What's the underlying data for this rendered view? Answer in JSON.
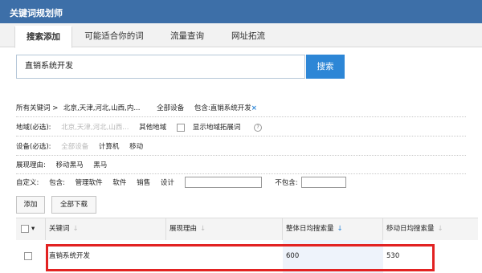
{
  "app": {
    "title": "关键词规划师"
  },
  "tabs": [
    {
      "label": "搜索添加"
    },
    {
      "label": "可能适合你的词"
    },
    {
      "label": "流量查询"
    },
    {
      "label": "网址拓流"
    }
  ],
  "search": {
    "value": "直销系统开发",
    "button": "搜索"
  },
  "breadcrumb": {
    "root": "所有关键词 >",
    "region": "北京,天津,河北,山西,内...",
    "device": "全部设备",
    "include": "包含:直销系统开发",
    "close": "×"
  },
  "filters": {
    "region": {
      "label": "地域(必选):",
      "value": "北京,天津,河北,山西...",
      "other": "其他地域",
      "checkbox_label": "显示地域拓展词",
      "help": "?"
    },
    "device": {
      "label": "设备(必选):",
      "options": [
        "全部设备",
        "计算机",
        "移动"
      ]
    },
    "reason": {
      "label": "展现理由:",
      "options": [
        "移动黑马",
        "黑马"
      ]
    },
    "custom": {
      "label": "自定义:",
      "include_label": "包含:",
      "include_options": [
        "管理软件",
        "软件",
        "销售",
        "设计"
      ],
      "exclude_label": "不包含:"
    }
  },
  "actions": {
    "add": "添加",
    "download_all": "全部下载"
  },
  "table": {
    "columns": [
      "关键词",
      "展现理由",
      "整体日均搜索量",
      "移动日均搜索量"
    ],
    "sort_gray": "↓",
    "sort_active": "↓",
    "select_icon": "▾",
    "rows": [
      {
        "keyword": "直销系统开发",
        "reason": "",
        "overall": "600",
        "mobile": "530"
      }
    ]
  }
}
